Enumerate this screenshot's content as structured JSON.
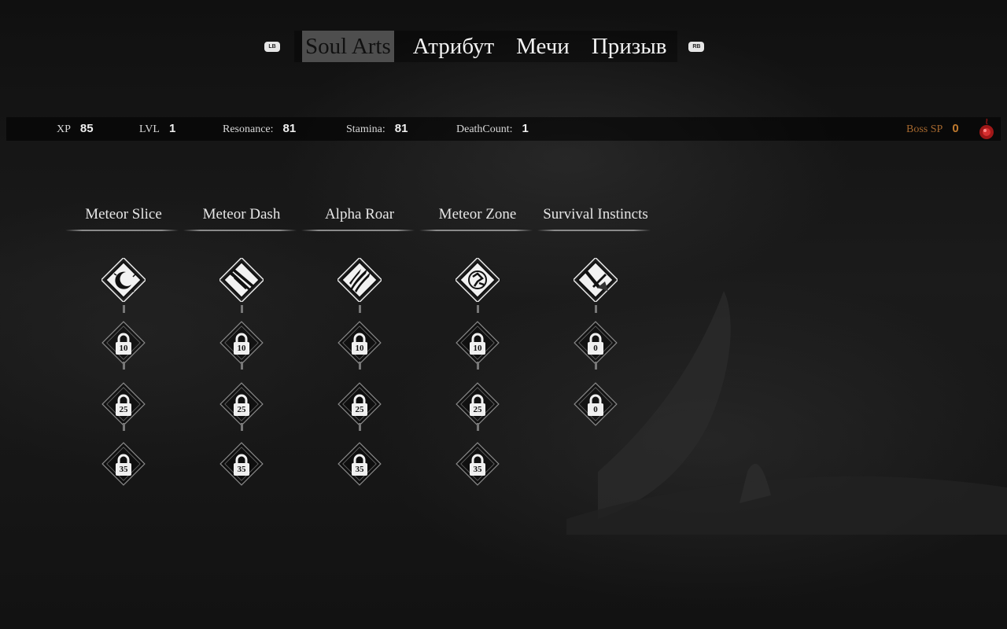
{
  "tabs": {
    "left_bumper": "LB",
    "right_bumper": "RB",
    "items": [
      {
        "label": "Soul Arts",
        "active": true
      },
      {
        "label": "Атрибут",
        "active": false
      },
      {
        "label": "Мечи",
        "active": false
      },
      {
        "label": "Призыв",
        "active": false
      }
    ]
  },
  "stats": {
    "xp_label": "XP",
    "xp_value": "85",
    "lvl_label": "LVL",
    "lvl_value": "1",
    "resonance_label": "Resonance:",
    "resonance_value": "81",
    "stamina_label": "Stamina:",
    "stamina_value": "81",
    "deathcount_label": "DeathCount:",
    "deathcount_value": "1",
    "boss_sp_label": "Boss SP",
    "boss_sp_value": "0",
    "boss_sp_color": "#c07a2e"
  },
  "skills": [
    {
      "name": "Meteor Slice",
      "icon": "crescent-moon-icon",
      "locks": [
        "10",
        "25",
        "35"
      ]
    },
    {
      "name": "Meteor Dash",
      "icon": "dash-streak-icon",
      "locks": [
        "10",
        "25",
        "35"
      ]
    },
    {
      "name": "Alpha Roar",
      "icon": "claw-slash-icon",
      "locks": [
        "10",
        "25",
        "35"
      ]
    },
    {
      "name": "Meteor Zone",
      "icon": "meteor-rune-icon",
      "locks": [
        "10",
        "25",
        "35"
      ]
    },
    {
      "name": "Survival Instincts",
      "icon": "sword-burst-icon",
      "locks": [
        "0",
        "0"
      ]
    }
  ]
}
